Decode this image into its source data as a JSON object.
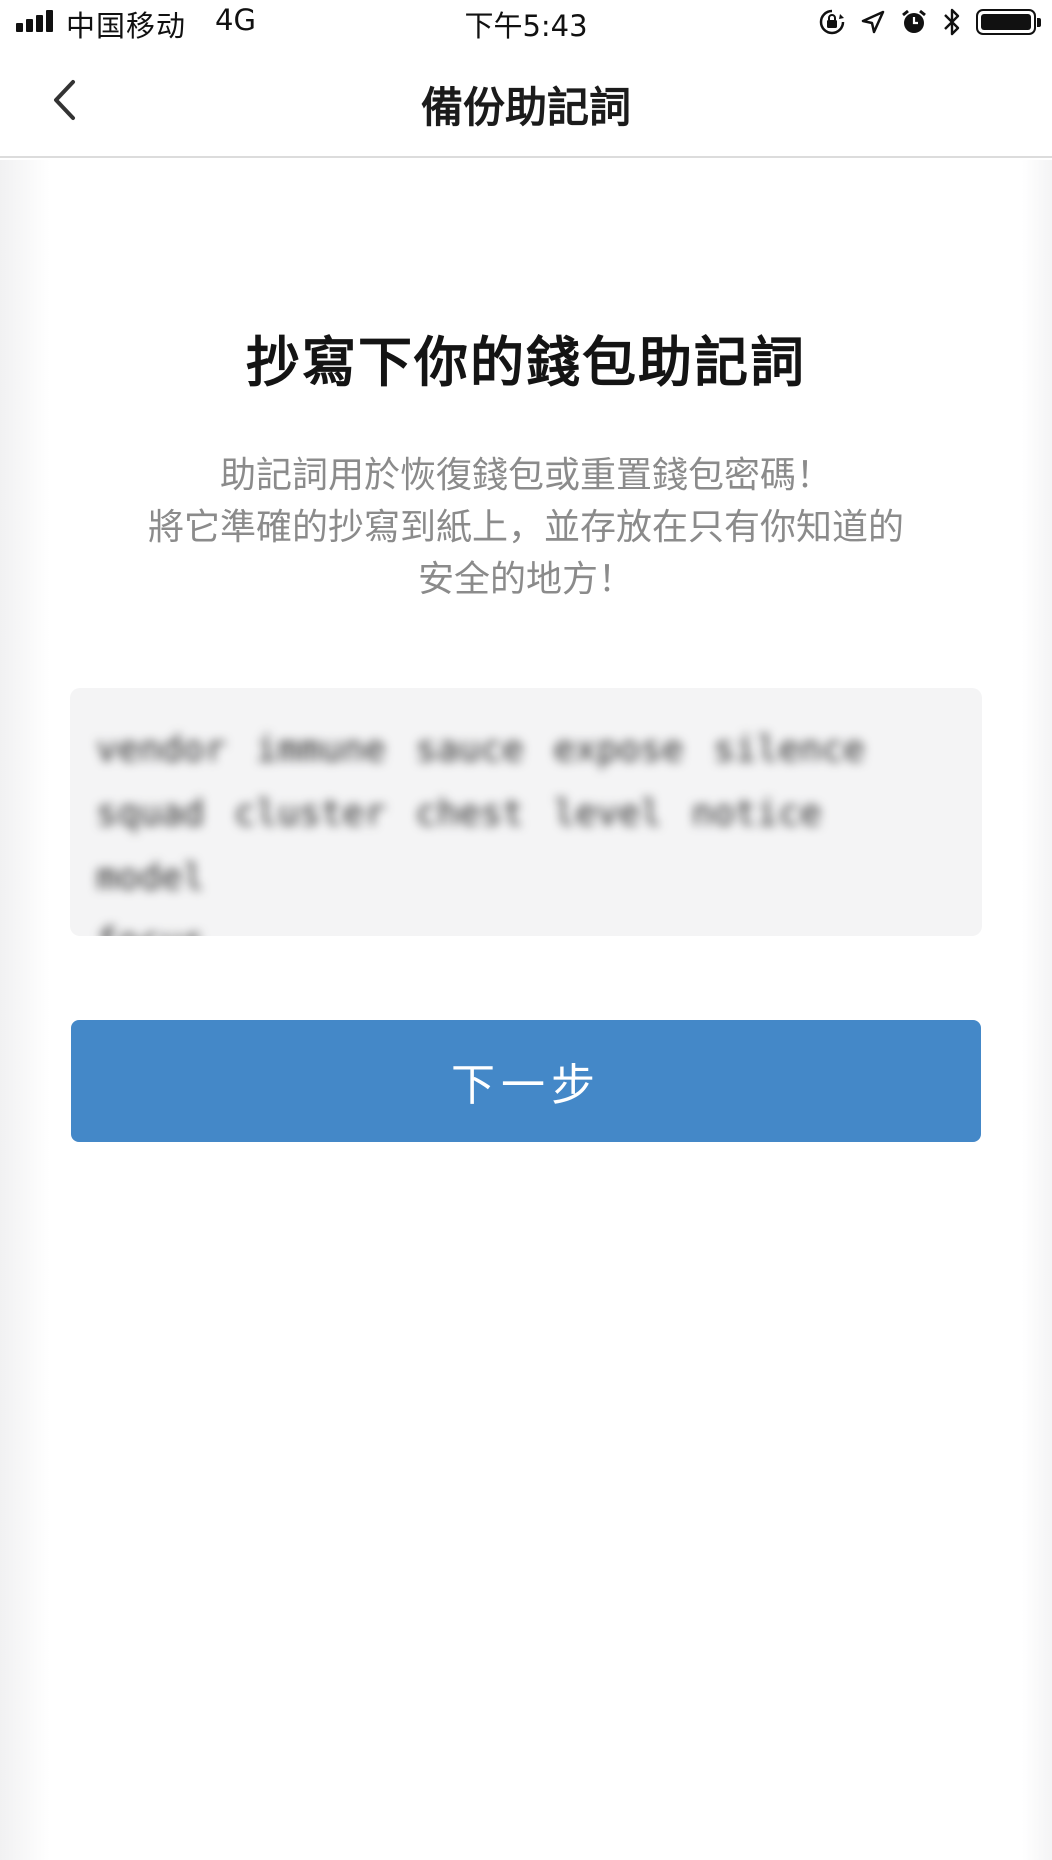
{
  "status_bar": {
    "carrier": "中国移动",
    "network": "4G",
    "time": "下午5:43",
    "icons": [
      "signal-icon",
      "orientation-lock-icon",
      "location-icon",
      "alarm-icon",
      "bluetooth-icon",
      "battery-icon"
    ]
  },
  "nav": {
    "back_icon": "chevron-left-icon",
    "title": "備份助記詞"
  },
  "main": {
    "heading": "抄寫下你的錢包助記詞",
    "description_lines": [
      "助記詞用於恢復錢包或重置錢包密碼！",
      "將它準確的抄寫到紙上，並存放在只有你知道的",
      "安全的地方！"
    ],
    "mnemonic_lines": [
      "vendor immune sauce expose silence",
      "squad cluster chest level notice model",
      "focus"
    ],
    "next_button_label": "下一步"
  },
  "colors": {
    "accent": "#4488c8",
    "description_text": "#8b8b8b",
    "mnemonic_bg": "#f4f4f5",
    "divider": "#dcdcdc"
  }
}
